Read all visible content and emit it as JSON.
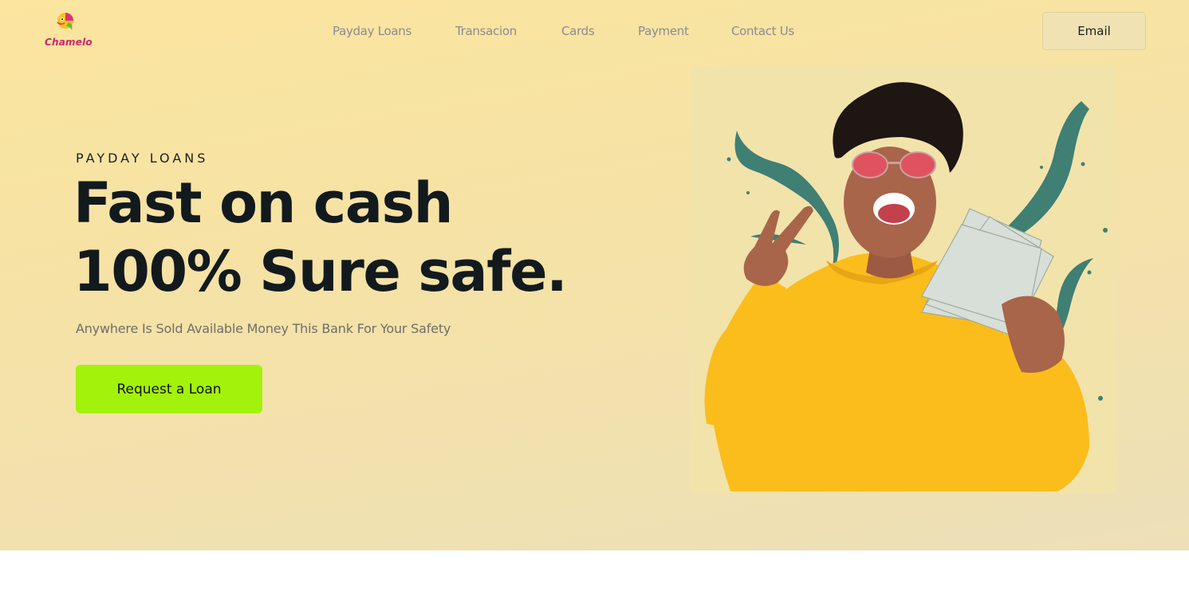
{
  "brand": {
    "name": "Chamelo"
  },
  "nav": {
    "items": [
      {
        "label": "Payday Loans"
      },
      {
        "label": "Transacion"
      },
      {
        "label": "Cards"
      },
      {
        "label": "Payment"
      },
      {
        "label": "Contact Us"
      }
    ],
    "email_button": "Email"
  },
  "hero": {
    "eyebrow": "PAYDAY LOANS",
    "headline_line1": "Fast on cash",
    "headline_line2": "100% Sure safe.",
    "subtitle": "Anywhere Is Sold Available Money This Bank For Your Safety",
    "cta_label": "Request a Loan"
  },
  "colors": {
    "hero_bg": "#fbe59f",
    "cta": "#a2f20b",
    "brand_text": "#d0246e",
    "nav_text": "#8b8b95",
    "sweater": "#fbbd1c",
    "splash": "#3f7f74"
  },
  "icons": {
    "logo": "chameleon-logo-icon"
  }
}
